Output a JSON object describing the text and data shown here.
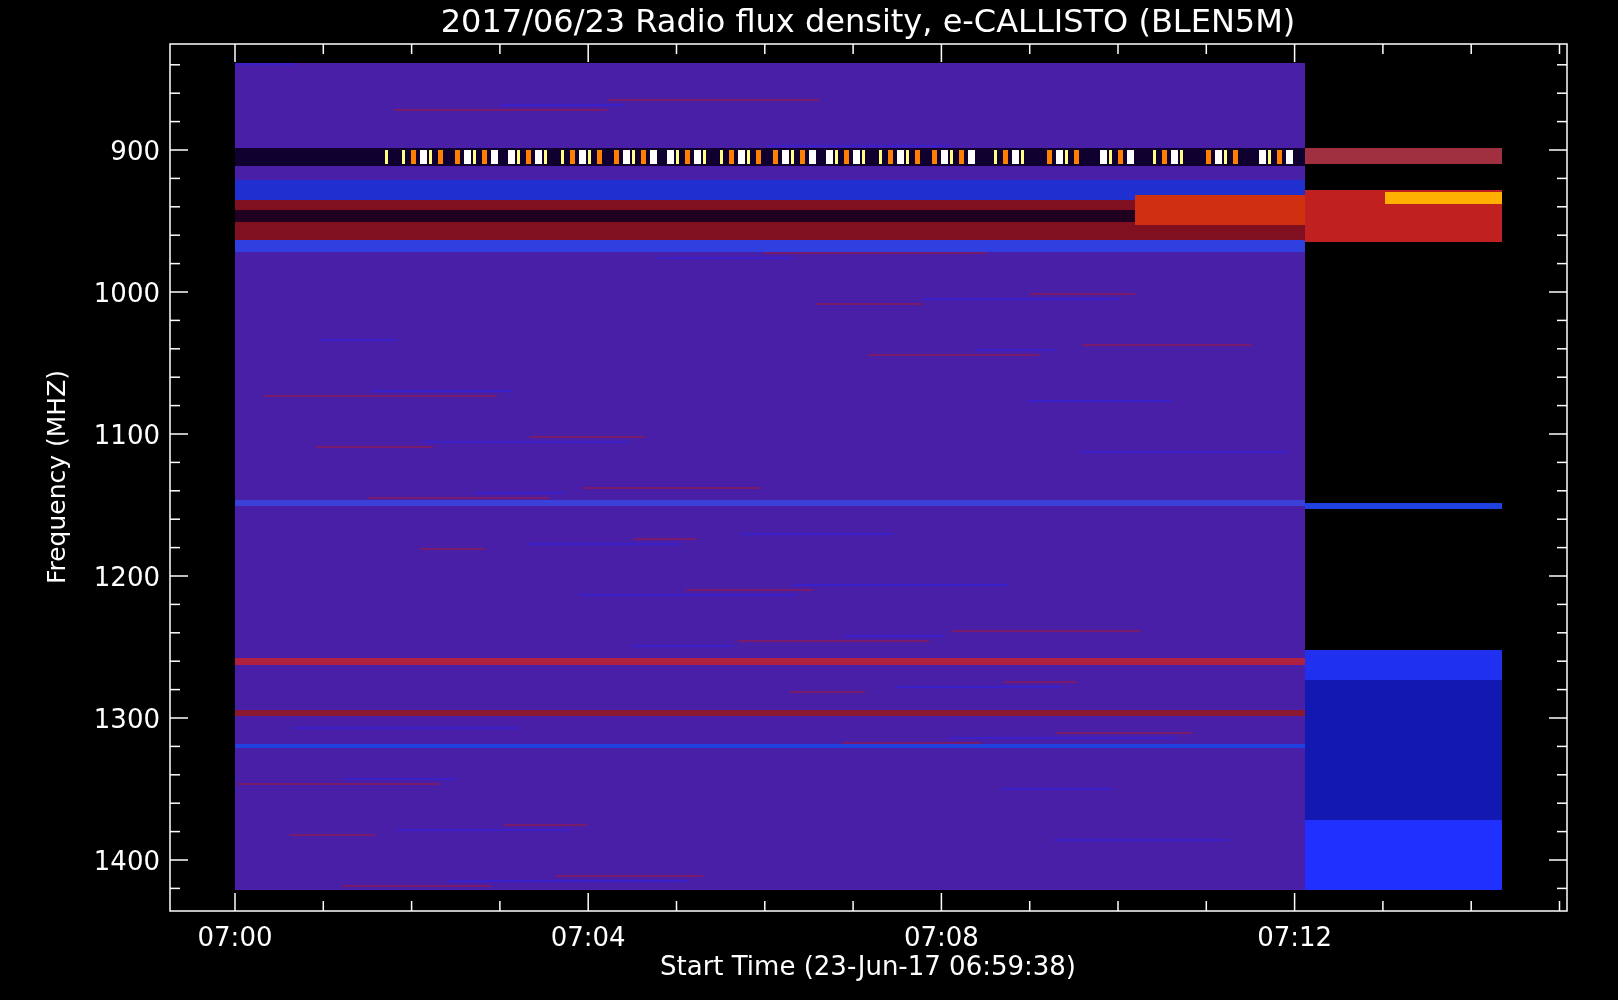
{
  "title": "2017/06/23  Radio flux density, e-CALLISTO (BLEN5M)",
  "y_axis": {
    "label": "Frequency (MHZ)",
    "ticks": [
      "900",
      "1000",
      "1100",
      "1200",
      "1300",
      "1400"
    ]
  },
  "x_axis": {
    "label": "Start Time (23-Jun-17 06:59:38)",
    "ticks": [
      "07:00",
      "07:04",
      "07:08",
      "07:12"
    ]
  }
}
